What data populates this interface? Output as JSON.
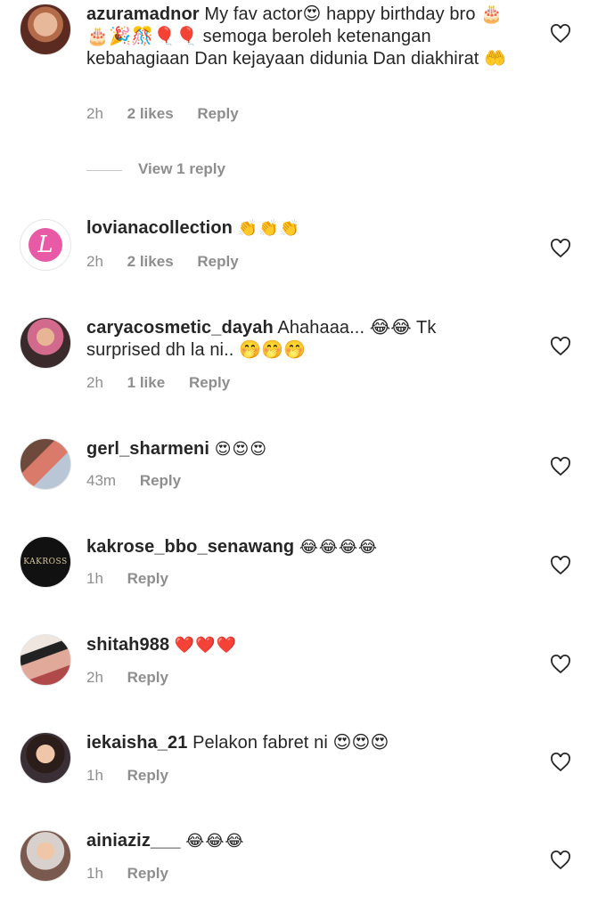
{
  "comments": [
    {
      "username": "azuramadnor",
      "text": "My fav actor😍 happy birthday bro 🎂🎂🎉🎊🎈🎈 semoga beroleh ketenangan kebahagiaan Dan kejayaan didunia Dan diakhirat 🤲",
      "time": "2h",
      "likes": "2 likes",
      "reply": "Reply",
      "avatar": "profile-photo-woman"
    },
    {
      "username": "lovianacollection",
      "text": "👏👏👏",
      "time": "2h",
      "likes": "2 likes",
      "reply": "Reply",
      "avatar": "brand-logo-L"
    },
    {
      "username": "caryacosmetic_dayah",
      "text": "Ahahaaa... 😂😂 Tk surprised dh la ni.. 🤭🤭🤭",
      "time": "2h",
      "likes": "1 like",
      "reply": "Reply",
      "avatar": "profile-photo-hijab"
    },
    {
      "username": "gerl_sharmeni",
      "text": "😍😍😍",
      "time": "43m",
      "likes": "",
      "reply": "Reply",
      "avatar": "profile-photo-family"
    },
    {
      "username": "kakrose_bbo_senawang",
      "text": "😂😂😂😂",
      "time": "1h",
      "likes": "",
      "reply": "Reply",
      "avatar": "brand-logo-kakross"
    },
    {
      "username": "shitah988",
      "text": "❤️❤️❤️",
      "time": "2h",
      "likes": "",
      "reply": "Reply",
      "avatar": "profile-photo-woman-2"
    },
    {
      "username": "iekaisha_21",
      "text": "Pelakon fabret ni 😍😍😍",
      "time": "1h",
      "likes": "",
      "reply": "Reply",
      "avatar": "profile-photo-woman-3"
    },
    {
      "username": "ainiaziz___",
      "text": "😂😂😂",
      "time": "1h",
      "likes": "",
      "reply": "Reply",
      "avatar": "profile-photo-hijab-2"
    }
  ],
  "view_replies": "View 1 reply",
  "brand_logo_text": "KAKROSS"
}
